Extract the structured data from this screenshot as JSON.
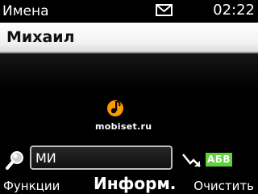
{
  "status": {
    "title": "Имена",
    "time": "02:22",
    "icon": "envelope-icon"
  },
  "contacts": [
    {
      "name": "Михаил"
    }
  ],
  "watermark": {
    "text": "mobiset.ru",
    "icon": "music-note-logo-icon"
  },
  "search": {
    "value": "МИ",
    "icon": "magnifier-icon"
  },
  "input_mode": {
    "label": "АБВ",
    "icon": "arrow-down-right-icon"
  },
  "softkeys": {
    "left": "Функции",
    "center": "Информ.",
    "right": "Очистить"
  },
  "colors": {
    "background": "#000000",
    "highlight": "#f2f2f2",
    "input_mode_badge": "#5fd13a",
    "watermark_orange": "#ff9900"
  }
}
